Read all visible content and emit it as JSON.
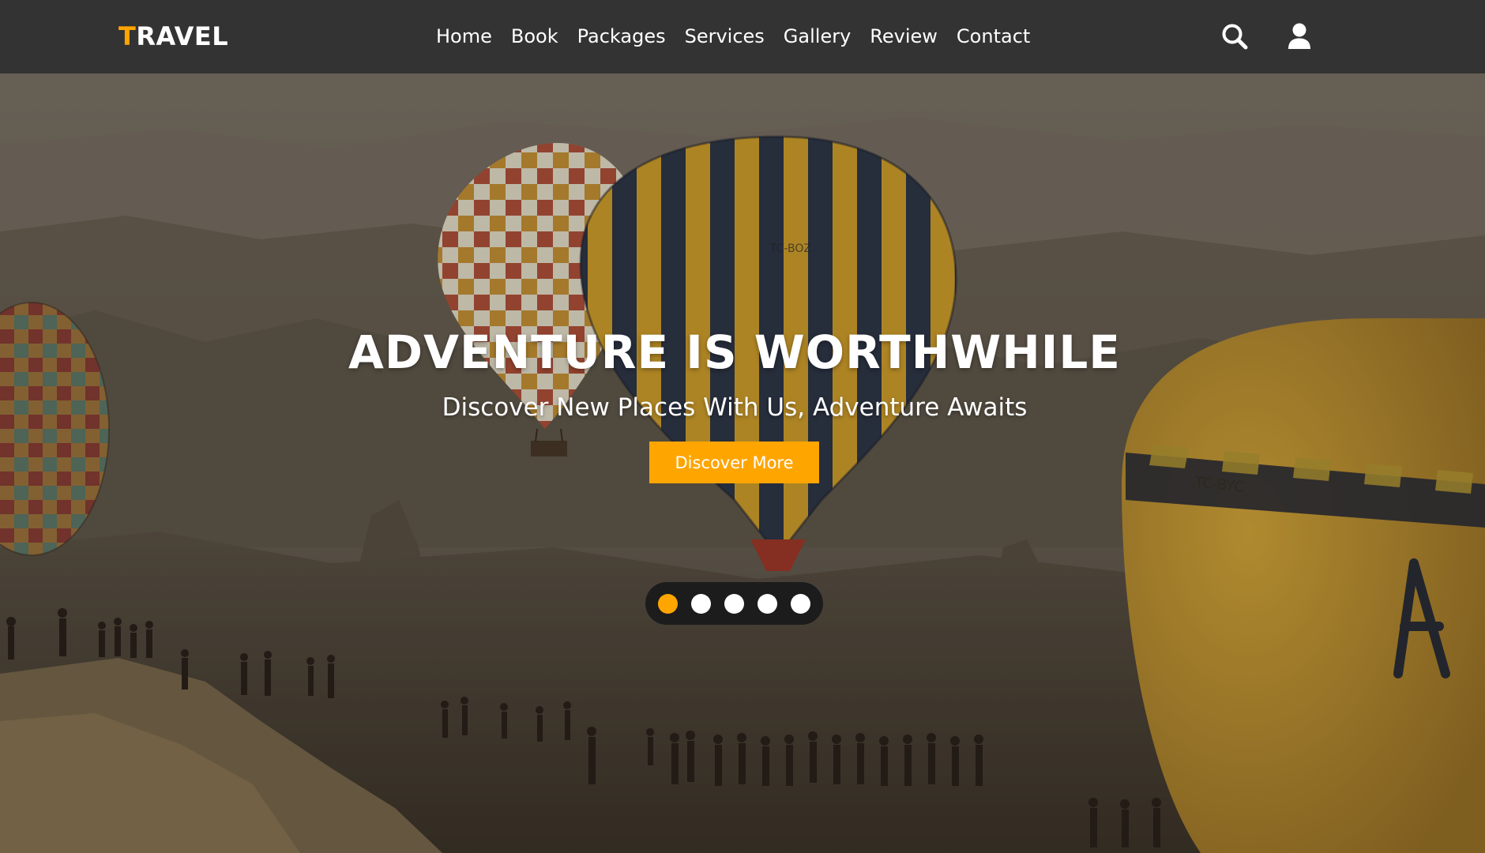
{
  "nav": {
    "logo_first": "T",
    "logo_rest": "RAVEL",
    "items": [
      {
        "label": "Home"
      },
      {
        "label": "Book"
      },
      {
        "label": "Packages"
      },
      {
        "label": "Services"
      },
      {
        "label": "Gallery"
      },
      {
        "label": "Review"
      },
      {
        "label": "Contact"
      }
    ],
    "icons": [
      "search-icon",
      "user-icon"
    ]
  },
  "hero": {
    "title": "ADVENTURE IS WORTHWHILE",
    "subtitle": "Discover New Places With Us, Adventure Awaits",
    "button_label": "Discover More",
    "balloon_markings": [
      "TC-BOZ",
      "TC-BYC"
    ],
    "slider": {
      "count": 5,
      "active_index": 0
    }
  },
  "colors": {
    "navbar_bg": "#333333",
    "accent": "#ffa500",
    "text": "#ffffff",
    "dots_bg": "#1c1c1c"
  }
}
